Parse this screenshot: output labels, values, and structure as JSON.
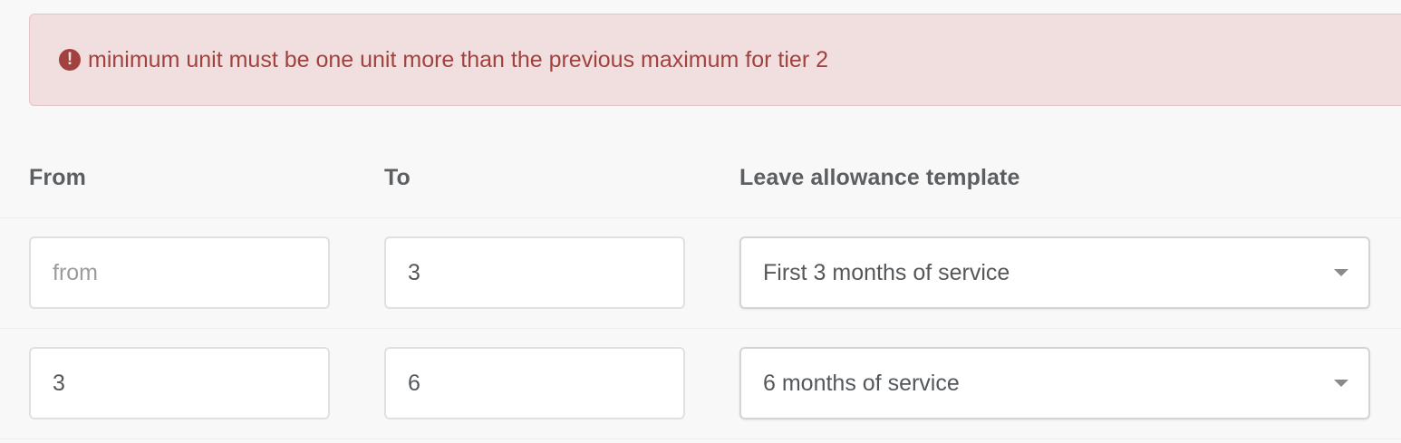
{
  "alert": {
    "icon": "exclamation-circle-icon",
    "icon_glyph": "!",
    "message": "minimum unit must be one unit more than the previous maximum for tier 2",
    "color": "#a2423f",
    "background": "#f1dfdf"
  },
  "table": {
    "headers": {
      "from": "From",
      "to": "To",
      "template": "Leave allowance template"
    },
    "rows": [
      {
        "from_value": "",
        "from_placeholder": "from",
        "to_value": "3",
        "template": "First 3 months of service"
      },
      {
        "from_value": "3",
        "from_placeholder": "",
        "to_value": "6",
        "template": "6 months of service"
      }
    ]
  }
}
